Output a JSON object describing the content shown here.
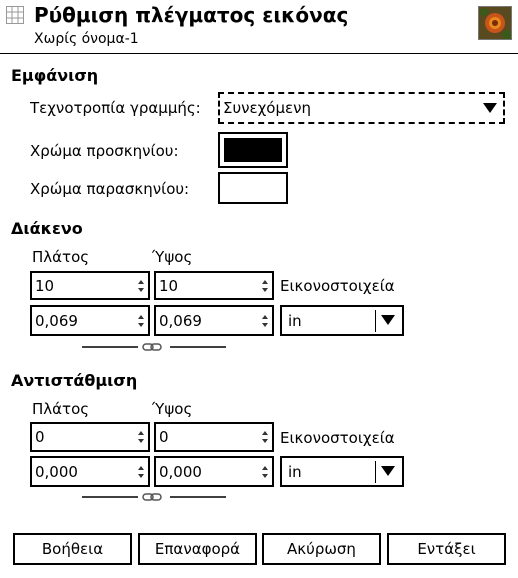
{
  "header": {
    "title": "Ρύθμιση πλέγματος εικόνας",
    "subtitle": "Χωρίς όνομα-1"
  },
  "appearance": {
    "section_label": "Εμφάνιση",
    "line_style_label": "Τεχνοτροπία γραμμής:",
    "line_style_value": "Συνεχόμενη",
    "fg_color_label": "Χρώμα προσκηνίου:",
    "fg_color": "#000000",
    "bg_color_label": "Χρώμα παρασκηνίου:",
    "bg_color": "#ffffff"
  },
  "spacing": {
    "section_label": "Διάκενο",
    "width_label": "Πλάτος",
    "height_label": "Ύψος",
    "width_px": "10",
    "height_px": "10",
    "px_unit_label": "Εικονοστοιχεία",
    "width_in": "0,069",
    "height_in": "0,069",
    "unit": "in"
  },
  "offset": {
    "section_label": "Αντιστάθμιση",
    "width_label": "Πλάτος",
    "height_label": "Ύψος",
    "width_px": "0",
    "height_px": "0",
    "px_unit_label": "Εικονοστοιχεία",
    "width_in": "0,000",
    "height_in": "0,000",
    "unit": "in"
  },
  "buttons": {
    "help": "Βοήθεια",
    "reset": "Επαναφορά",
    "cancel": "Ακύρωση",
    "ok": "Εντάξει"
  }
}
